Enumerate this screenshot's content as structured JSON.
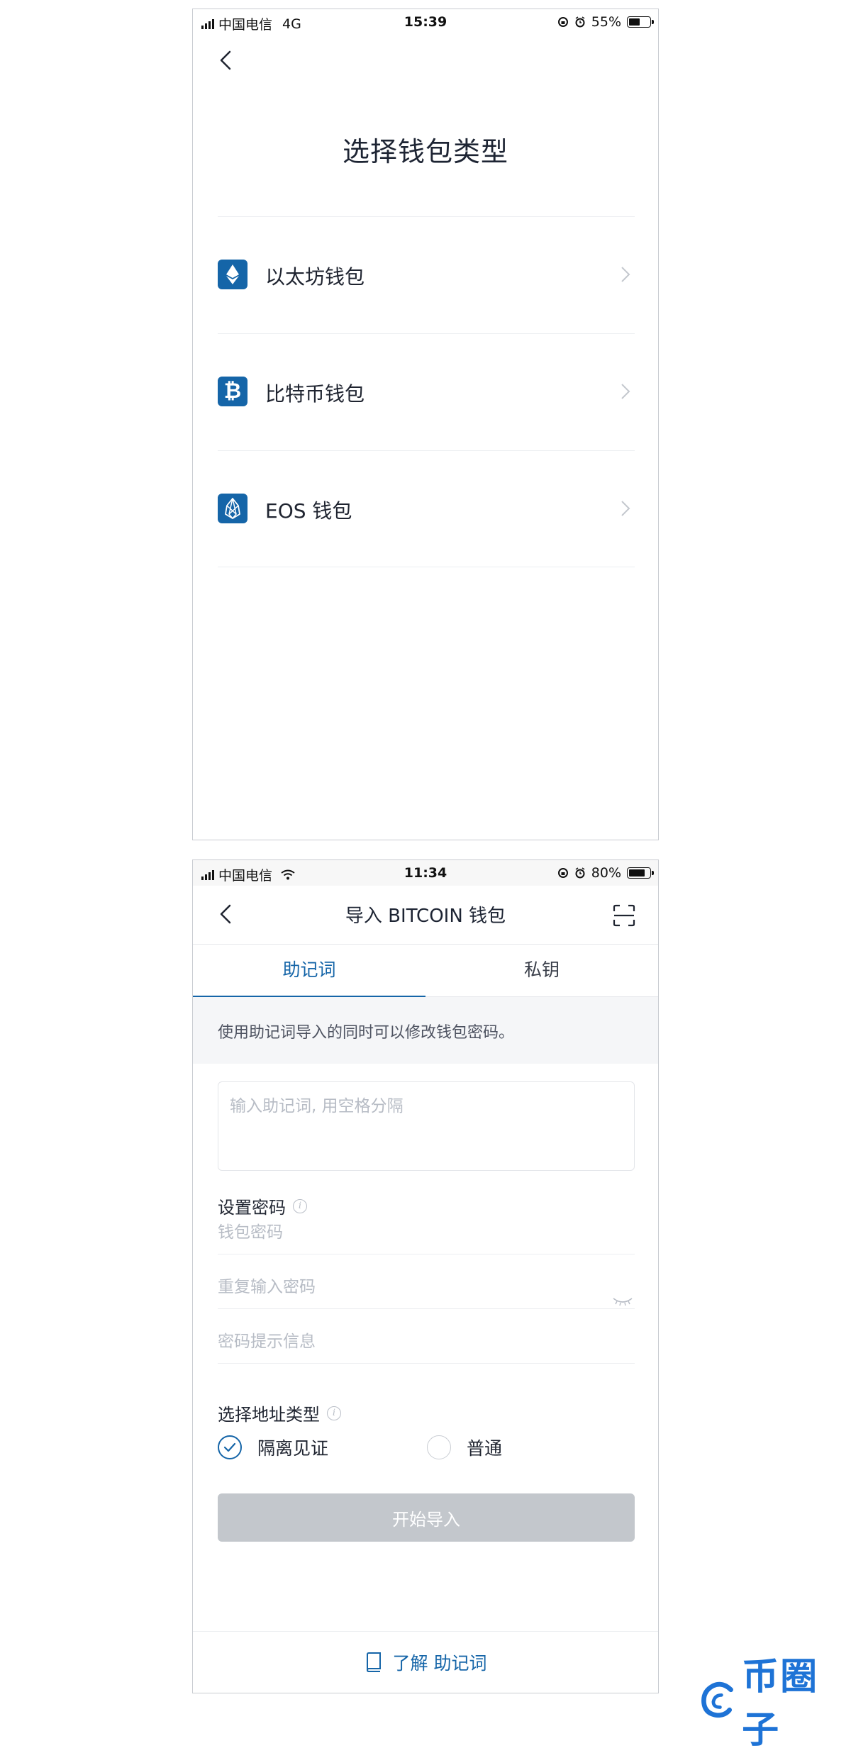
{
  "screen1": {
    "status": {
      "carrier": "中国电信",
      "network": "4G",
      "time": "15:39",
      "battery": "55%",
      "battery_level": 0.55
    },
    "title": "选择钱包类型",
    "wallets": [
      {
        "label": "以太坊钱包",
        "icon": "ethereum-icon"
      },
      {
        "label": "比特币钱包",
        "icon": "bitcoin-icon"
      },
      {
        "label": "EOS 钱包",
        "icon": "eos-icon"
      }
    ]
  },
  "screen2": {
    "status": {
      "carrier": "中国电信",
      "network": "wifi-icon",
      "time": "11:34",
      "battery": "80%",
      "battery_level": 0.8
    },
    "title": "导入 BITCOIN 钱包",
    "tabs": [
      {
        "label": "助记词",
        "active": true
      },
      {
        "label": "私钥",
        "active": false
      }
    ],
    "hint": "使用助记词导入的同时可以修改钱包密码。",
    "mnemonic_placeholder": "输入助记词, 用空格分隔",
    "password_section": "设置密码",
    "password_placeholder": "钱包密码",
    "repeat_placeholder": "重复输入密码",
    "hint_placeholder": "密码提示信息",
    "address_section": "选择地址类型",
    "address_types": [
      {
        "label": "隔离见证",
        "selected": true
      },
      {
        "label": "普通",
        "selected": false
      }
    ],
    "start_button": "开始导入",
    "learn_link": "了解 助记词"
  },
  "watermark": "币圈子",
  "colors": {
    "accent": "#1565a8",
    "disabled_button": "#c3c7cc",
    "placeholder": "#b7bcc5"
  }
}
